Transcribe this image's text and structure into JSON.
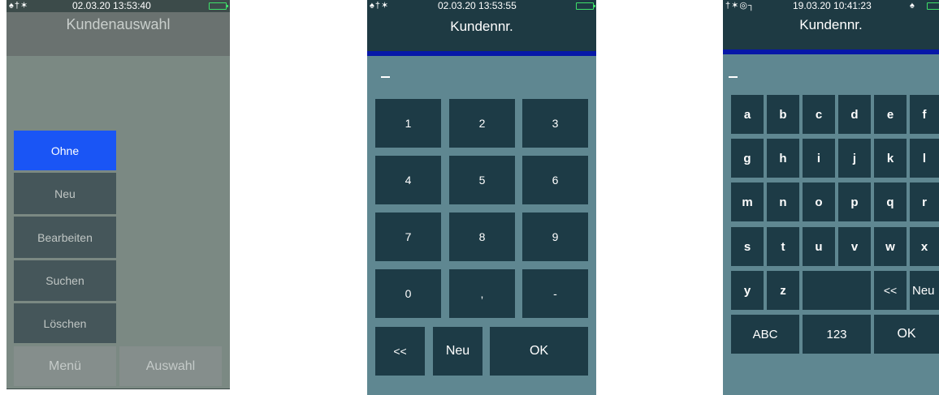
{
  "screen1": {
    "status_time": "02.03.20 13:53:40",
    "title": "Kundenauswahl",
    "menu_items": [
      "Ohne",
      "Neu",
      "Bearbeiten",
      "Suchen",
      "Löschen"
    ],
    "softkey_left": "Menü",
    "softkey_right": "Auswahl"
  },
  "screen2": {
    "status_time": "02.03.20 13:53:55",
    "title": "Kundennr.",
    "input_value": "",
    "keys": [
      "1",
      "2",
      "3",
      "4",
      "5",
      "6",
      "7",
      "8",
      "9",
      "0",
      ",",
      "-"
    ],
    "backspace": "<<",
    "new": "Neu",
    "ok": "OK"
  },
  "screen3": {
    "status_time": "19.03.20 10:41:23",
    "title": "Kundennr.",
    "input_value": "",
    "keys": [
      "a",
      "b",
      "c",
      "d",
      "e",
      "f",
      "g",
      "h",
      "i",
      "j",
      "k",
      "l",
      "m",
      "n",
      "o",
      "p",
      "q",
      "r",
      "s",
      "t",
      "u",
      "v",
      "w",
      "x",
      "y",
      "z"
    ],
    "backspace": "<<",
    "new": "Neu",
    "abc": "ABC",
    "num": "123",
    "ok": "OK"
  },
  "colors": {
    "key_bg": "#1d3b46",
    "screen_bg": "#5f8791",
    "selected": "#1a55f5",
    "accent_bar": "#0718a8"
  }
}
